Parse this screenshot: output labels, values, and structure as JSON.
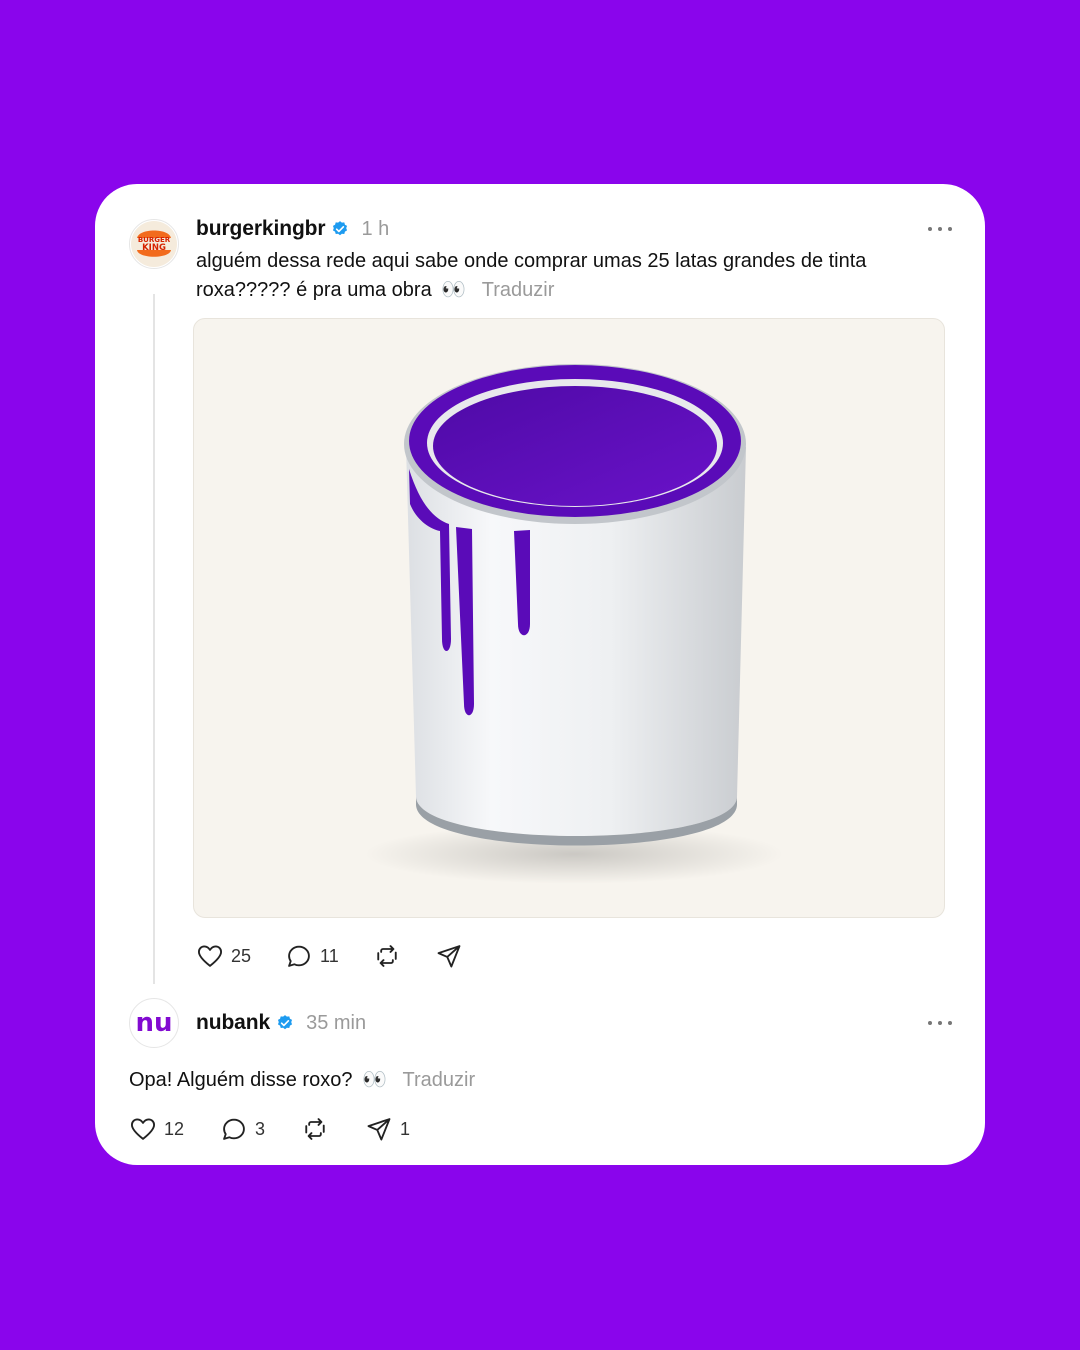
{
  "colors": {
    "background": "#8A05EC",
    "card": "#ffffff",
    "paint": "#5A0BB8",
    "verified": "#1D9BF0"
  },
  "posts": [
    {
      "username": "burgerkingbr",
      "verified": true,
      "time": "1 h",
      "avatar": {
        "icon": "burger-king-logo",
        "text_line1": "BURGER",
        "text_line2": "KING"
      },
      "text": "alguém dessa rede aqui sabe onde comprar umas 25 latas grandes de tinta roxa????? é pra uma obra",
      "emoji": "👀",
      "translate_label": "Traduzir",
      "image": {
        "description_icon": "purple-paint-can-image"
      },
      "actions": {
        "likes": "25",
        "comments": "11",
        "repost_icon": "repost-icon",
        "share_icon": "share-icon"
      }
    },
    {
      "username": "nubank",
      "verified": true,
      "time": "35 min",
      "avatar": {
        "icon": "nubank-logo",
        "text": "nu"
      },
      "text": "Opa! Alguém disse roxo?",
      "emoji": "👀",
      "translate_label": "Traduzir",
      "actions": {
        "likes": "12",
        "comments": "3",
        "repost_icon": "repost-icon",
        "shares": "1"
      }
    }
  ]
}
